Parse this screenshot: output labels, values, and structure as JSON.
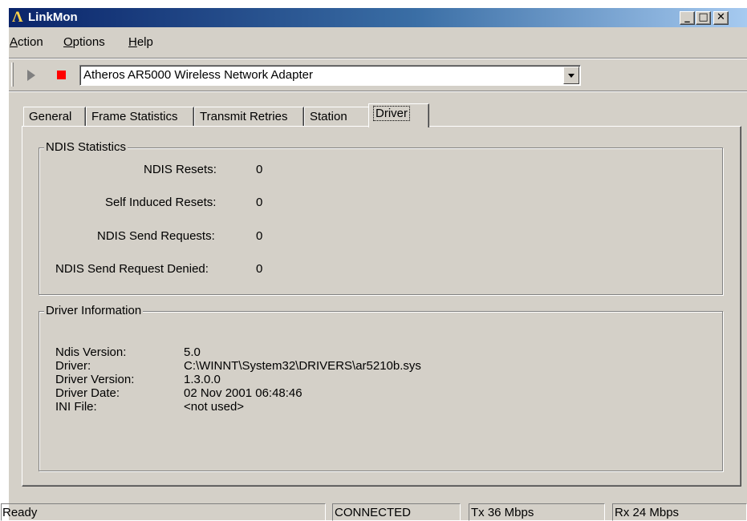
{
  "window": {
    "title": "LinkMon",
    "logo": "Λ",
    "controls": {
      "minimize": "_",
      "maximize": "□",
      "close": "✕"
    }
  },
  "menu": [
    {
      "label_u": "A",
      "label_rest": "ction"
    },
    {
      "label_u": "O",
      "label_rest": "ptions"
    },
    {
      "label_u": "H",
      "label_rest": "elp"
    }
  ],
  "toolbar": {
    "play_icon": "play-icon",
    "stop_icon": "stop-icon",
    "adapter_selected": "Atheros AR5000 Wireless Network Adapter"
  },
  "tabs": [
    "General",
    "Frame Statistics",
    "Transmit Retries",
    "Station",
    "Driver"
  ],
  "active_tab": "Driver",
  "ndis_statistics": {
    "title": "NDIS Statistics",
    "rows": [
      {
        "label": "NDIS Resets:",
        "value": "0"
      },
      {
        "label": "Self Induced Resets:",
        "value": "0"
      },
      {
        "label": "NDIS Send Requests:",
        "value": "0"
      },
      {
        "label": "NDIS Send Request Denied:",
        "value": "0"
      }
    ]
  },
  "driver_information": {
    "title": "Driver Information",
    "rows": [
      {
        "label": "Ndis Version:",
        "value": "5.0"
      },
      {
        "label": "Driver:",
        "value": "C:\\WINNT\\System32\\DRIVERS\\ar5210b.sys"
      },
      {
        "label": "Driver Version:",
        "value": "1.3.0.0"
      },
      {
        "label": "Driver Date:",
        "value": "02 Nov 2001 06:48:46"
      },
      {
        "label": "INI File:",
        "value": "<not used>"
      }
    ]
  },
  "status": {
    "message": "Ready",
    "connection": "CONNECTED",
    "tx": "Tx 36 Mbps",
    "rx": "Rx 24 Mbps"
  },
  "colors": {
    "title_gradient_start": "#0a246a",
    "title_gradient_end": "#a6caf0",
    "face": "#d4d0c8",
    "stop_red": "#ff0000"
  }
}
